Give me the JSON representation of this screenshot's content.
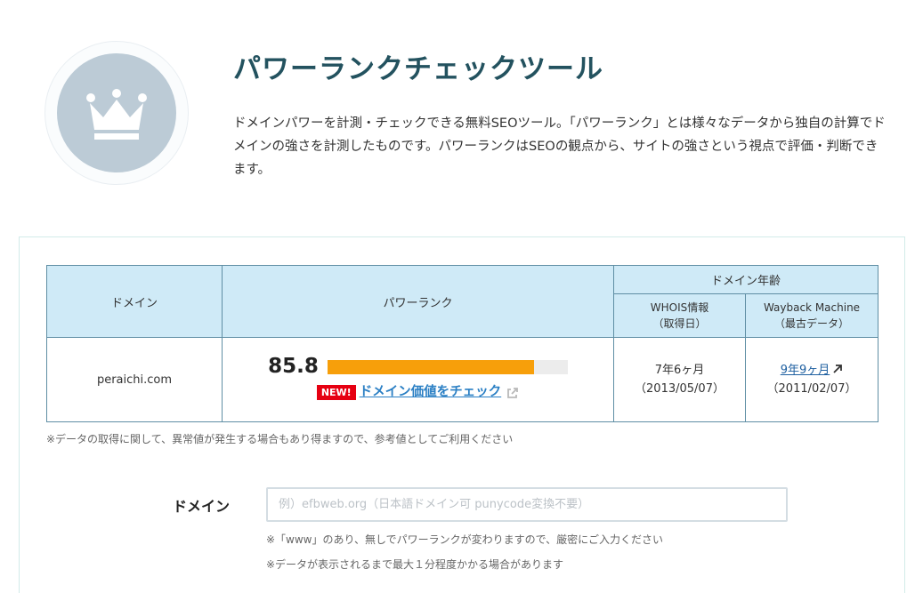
{
  "header": {
    "logo_icon": "crown-icon",
    "title": "パワーランクチェックツール",
    "description": "ドメインパワーを計測・チェックできる無料SEOツール。「パワーランク」とは様々なデータから独自の計算でドメインの強さを計測したものです。パワーランクはSEOの観点から、サイトの強さという視点で評価・判断できます。"
  },
  "result_table": {
    "headers": {
      "domain": "ドメイン",
      "power_rank": "パワーランク",
      "domain_age": "ドメイン年齢",
      "whois": "WHOIS情報",
      "whois_sub": "（取得日）",
      "wayback": "Wayback Machine",
      "wayback_sub": "（最古データ）"
    },
    "row": {
      "domain": "peraichi.com",
      "score": "85.8",
      "score_fraction": 0.858,
      "new_badge": "NEW!",
      "value_link": "ドメイン価値をチェック",
      "whois_age": "7年6ヶ月",
      "whois_date": "（2013/05/07）",
      "wayback_age": "9年9ヶ月",
      "wayback_date": "（2011/02/07）"
    }
  },
  "note": "※データの取得に関して、異常値が発生する場合もあり得ますので、参考値としてご利用ください",
  "form": {
    "label": "ドメイン",
    "value": "",
    "placeholder": "例）efbweb.org（日本語ドメイン可 punycode変換不要）",
    "hint1": "※「www」のあり、無しでパワーランクが変わりますので、厳密にご入力ください",
    "hint2": "※データが表示されるまで最大１分程度かかる場合があります"
  },
  "colors": {
    "title": "#23525f",
    "table_header_bg": "#cfeaf7",
    "table_border": "#5f8ea4",
    "bar_fill": "#f79f0a",
    "new_badge": "#e60012",
    "link": "#2a7fc4"
  }
}
